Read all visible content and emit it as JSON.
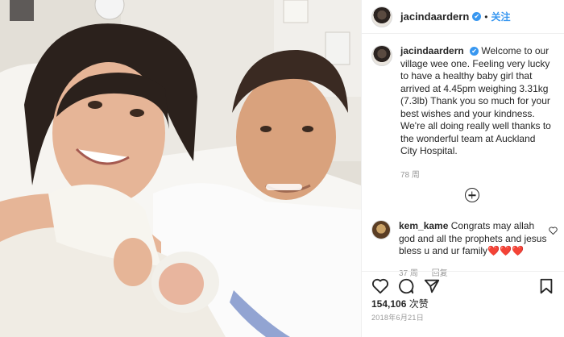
{
  "header": {
    "username": "jacindaardern",
    "verified_mark": "✔",
    "separator": "•",
    "follow_label": "关注"
  },
  "caption": {
    "username": "jacindaardern",
    "verified_mark": "✔",
    "text": "Welcome to our village wee one. Feeling very lucky to have a healthy baby girl that arrived at 4.45pm weighing 3.31kg (7.3lb) Thank you so much for your best wishes and your kindness. We're all doing really well thanks to the wonderful team at Auckland City Hospital.",
    "time": "78 周"
  },
  "comment": {
    "username": "kem_kame",
    "text": "Congrats may allah god and all the prophets and jesus bless u and ur family",
    "emoji": "❤️❤️❤️",
    "time": "37 周",
    "reply_label": "回复"
  },
  "likes": {
    "count": "154,106",
    "label": "次赞"
  },
  "date": "2018年6月21日",
  "icons": {
    "more_comments": "plus-circle-icon",
    "like": "heart-icon",
    "comment": "comment-icon",
    "share": "share-icon",
    "save": "bookmark-icon"
  }
}
